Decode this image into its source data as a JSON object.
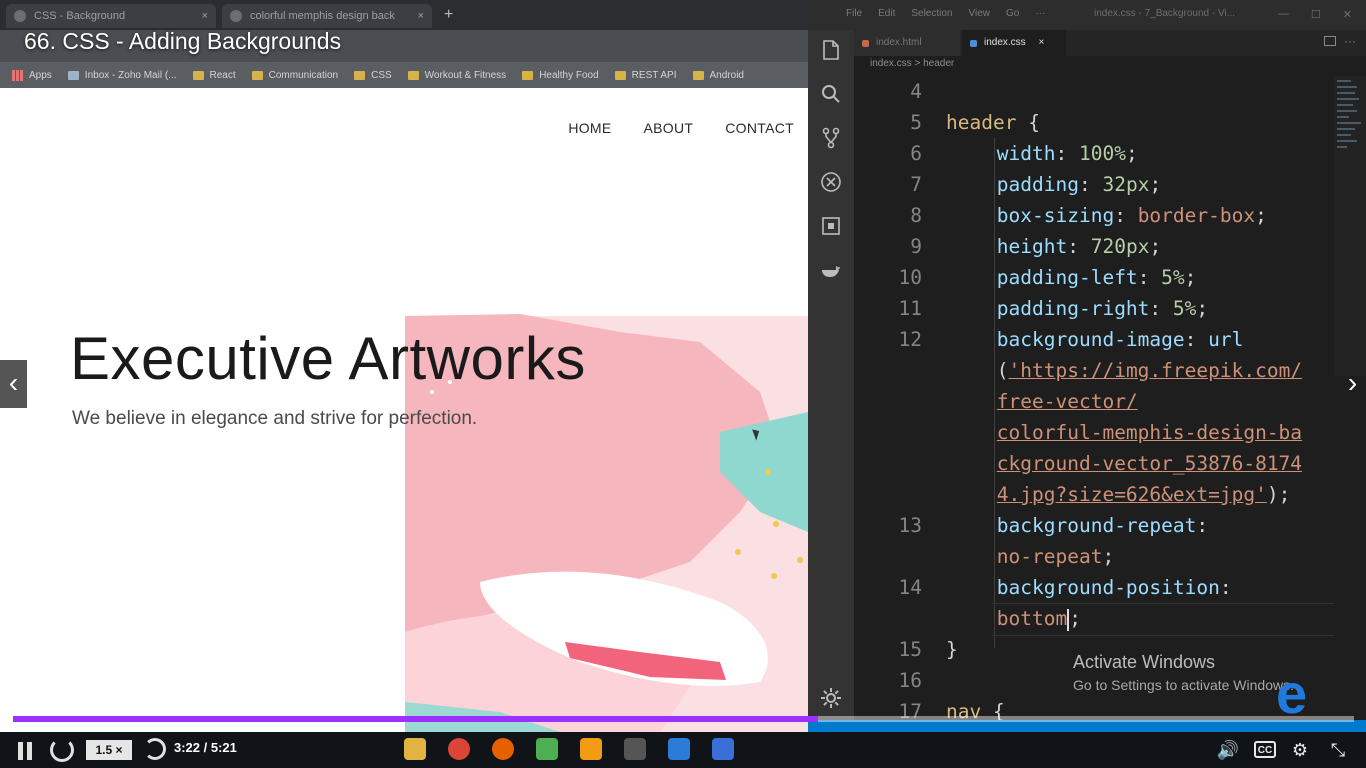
{
  "video": {
    "title": "66. CSS - Adding Backgrounds"
  },
  "browser": {
    "tabs": [
      {
        "label": "CSS - Background"
      },
      {
        "label": "colorful memphis design back"
      }
    ],
    "bookmarks": [
      {
        "label": "Apps",
        "icon": "apps-grid-icon"
      },
      {
        "label": "Inbox - Zoho Mail (...",
        "icon": "zoho-mail-icon"
      },
      {
        "label": "React",
        "icon": "folder-icon"
      },
      {
        "label": "Communication",
        "icon": "folder-icon"
      },
      {
        "label": "CSS",
        "icon": "folder-icon"
      },
      {
        "label": "Workout & Fitness",
        "icon": "folder-icon"
      },
      {
        "label": "Healthy Food",
        "icon": "folder-icon"
      },
      {
        "label": "REST API",
        "icon": "folder-icon"
      },
      {
        "label": "Android",
        "icon": "folder-icon"
      }
    ]
  },
  "webpage": {
    "nav": [
      "HOME",
      "ABOUT",
      "CONTACT"
    ],
    "heading": "Executive Artworks",
    "tagline": "We believe in elegance and strive for perfection."
  },
  "editor": {
    "menu": [
      "File",
      "Edit",
      "Selection",
      "View",
      "Go",
      "···"
    ],
    "window_title": "index.css - 7_Background - Vi...",
    "tabs": [
      {
        "label": "index.html",
        "active": false
      },
      {
        "label": "index.css",
        "active": true,
        "close": "×"
      }
    ],
    "breadcrumb": "index.css > header",
    "code": [
      {
        "ln": "4",
        "parts": []
      },
      {
        "ln": "5",
        "indent": 0,
        "parts": [
          [
            "sel",
            "header"
          ],
          [
            "brace",
            " {"
          ]
        ]
      },
      {
        "ln": "6",
        "indent": 2,
        "parts": [
          [
            "prop",
            "width"
          ],
          [
            "punc",
            ": "
          ],
          [
            "num",
            "100%"
          ],
          [
            "punc",
            ";"
          ]
        ]
      },
      {
        "ln": "7",
        "indent": 2,
        "parts": [
          [
            "prop",
            "padding"
          ],
          [
            "punc",
            ": "
          ],
          [
            "num",
            "32px"
          ],
          [
            "punc",
            ";"
          ]
        ]
      },
      {
        "ln": "8",
        "indent": 2,
        "parts": [
          [
            "prop",
            "box-sizing"
          ],
          [
            "punc",
            ": "
          ],
          [
            "val",
            "border-box"
          ],
          [
            "punc",
            ";"
          ]
        ]
      },
      {
        "ln": "9",
        "indent": 2,
        "parts": [
          [
            "prop",
            "height"
          ],
          [
            "punc",
            ": "
          ],
          [
            "num",
            "720px"
          ],
          [
            "punc",
            ";"
          ]
        ]
      },
      {
        "ln": "10",
        "indent": 2,
        "parts": [
          [
            "prop",
            "padding-left"
          ],
          [
            "punc",
            ": "
          ],
          [
            "num",
            "5%"
          ],
          [
            "punc",
            ";"
          ]
        ]
      },
      {
        "ln": "11",
        "indent": 2,
        "parts": [
          [
            "prop",
            "padding-right"
          ],
          [
            "punc",
            ": "
          ],
          [
            "num",
            "5%"
          ],
          [
            "punc",
            ";"
          ]
        ]
      },
      {
        "ln": "12",
        "indent": 2,
        "parts": [
          [
            "prop",
            "background-image"
          ],
          [
            "punc",
            ": "
          ],
          [
            "prop",
            "url"
          ]
        ]
      },
      {
        "ln": "",
        "indent": 2,
        "parts": [
          [
            "punc",
            "("
          ],
          [
            "str",
            "'https://img.freepik.com/"
          ]
        ]
      },
      {
        "ln": "",
        "indent": 2,
        "parts": [
          [
            "str",
            "free-vector/"
          ]
        ]
      },
      {
        "ln": "",
        "indent": 2,
        "parts": [
          [
            "str",
            "colorful-memphis-design-ba"
          ]
        ]
      },
      {
        "ln": "",
        "indent": 2,
        "parts": [
          [
            "str",
            "ckground-vector_53876-8174"
          ]
        ]
      },
      {
        "ln": "",
        "indent": 2,
        "parts": [
          [
            "str",
            "4.jpg?size=626&ext=jpg'"
          ],
          [
            "punc",
            ");"
          ]
        ]
      },
      {
        "ln": "13",
        "indent": 2,
        "parts": [
          [
            "prop",
            "background-repeat"
          ],
          [
            "punc",
            ":"
          ]
        ]
      },
      {
        "ln": "",
        "indent": 2,
        "parts": [
          [
            "val",
            "no-repeat"
          ],
          [
            "punc",
            ";"
          ]
        ]
      },
      {
        "ln": "14",
        "indent": 2,
        "parts": [
          [
            "prop",
            "background-position"
          ],
          [
            "punc",
            ":"
          ]
        ]
      },
      {
        "ln": "",
        "indent": 2,
        "parts": [
          [
            "val",
            "bottom"
          ],
          [
            "caret",
            ""
          ],
          [
            "punc",
            ";"
          ]
        ]
      },
      {
        "ln": "15",
        "indent": 0,
        "parts": [
          [
            "brace",
            "}"
          ]
        ]
      },
      {
        "ln": "16",
        "parts": []
      },
      {
        "ln": "17",
        "indent": 0,
        "parts": [
          [
            "sel",
            "nav"
          ],
          [
            "brace",
            " {"
          ]
        ]
      }
    ]
  },
  "watermark": {
    "title": "Activate Windows",
    "subtitle": "Go to Settings to activate Windows."
  },
  "player": {
    "speed": "1.5 ×",
    "time": "3:22 / 5:21",
    "progress": 0.6,
    "cc_label": "CC",
    "colors": {
      "progress": "#9b30ff",
      "accent": "#007acc"
    }
  },
  "nav_arrows": {
    "prev": "‹",
    "next": "›"
  }
}
